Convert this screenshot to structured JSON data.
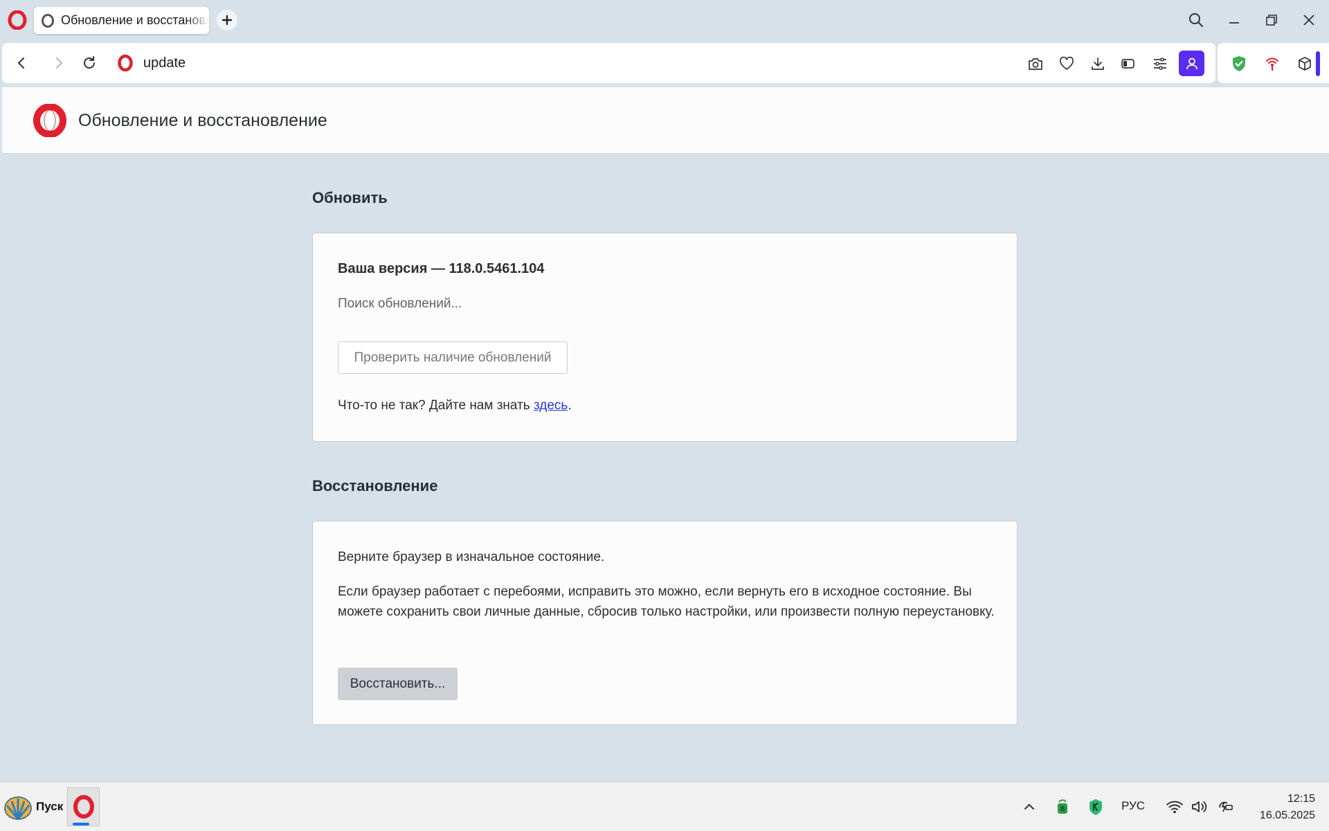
{
  "browser": {
    "tab": {
      "title": "Обновление и восстановление"
    },
    "address": {
      "url": "update"
    }
  },
  "page": {
    "header": {
      "title": "Обновление и восстановление"
    },
    "update": {
      "section_title": "Обновить",
      "version_text": "Ваша версия — 118.0.5461.104",
      "status_text": "Поиск обновлений...",
      "check_button": "Проверить наличие обновлений",
      "feedback_prefix": "Что-то не так? Дайте нам знать ",
      "feedback_link": "здесь",
      "feedback_suffix": "."
    },
    "recovery": {
      "section_title": "Восстановление",
      "intro": "Верните браузер в изначальное состояние.",
      "description": "Если браузер работает с перебоями, исправить это можно, если вернуть его в исходное состояние. Вы можете сохранить свои личные данные, сбросив только настройки, или произвести полную переустановку.",
      "restore_button": "Восстановить..."
    }
  },
  "taskbar": {
    "start_label": "Пуск",
    "language": "РУС",
    "time": "12:15",
    "date": "16.05.2025"
  },
  "colors": {
    "accent": "#5b2cf2",
    "opera_red": "#e0202e",
    "link": "#2a36e0",
    "background": "#d7e1ea"
  }
}
